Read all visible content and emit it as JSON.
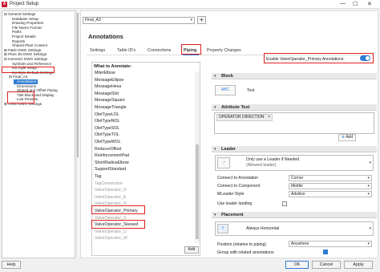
{
  "window": {
    "title": "Project Setup",
    "minimize": "—",
    "maximize": "☐",
    "close": "✕"
  },
  "tree": {
    "items": [
      {
        "label": "General Settings",
        "indent": 0,
        "prefix": "⊟"
      },
      {
        "label": "Database Setup",
        "indent": 1,
        "prefix": ""
      },
      {
        "label": "Drawing Properties",
        "indent": 1,
        "prefix": ""
      },
      {
        "label": "File Name Format",
        "indent": 1,
        "prefix": ""
      },
      {
        "label": "Paths",
        "indent": 1,
        "prefix": ""
      },
      {
        "label": "Project Details",
        "indent": 1,
        "prefix": ""
      },
      {
        "label": "Reports",
        "indent": 1,
        "prefix": ""
      },
      {
        "label": "Shared Plant Content",
        "indent": 1,
        "prefix": ""
      },
      {
        "label": "P&ID DWG Settings",
        "indent": 0,
        "prefix": "⊞"
      },
      {
        "label": "Plant 3D DWG Settings",
        "indent": 0,
        "prefix": "⊞"
      },
      {
        "label": "Isometric DWG Settings",
        "indent": 0,
        "prefix": "⊟"
      },
      {
        "label": "Symbols and Reference",
        "indent": 1,
        "prefix": ""
      },
      {
        "label": "Iso Style Setup",
        "indent": 1,
        "prefix": ""
      },
      {
        "label": "Iso Style Default Settings",
        "indent": 1,
        "prefix": ""
      },
      {
        "label": "Final_A3",
        "indent": 1,
        "prefix": "⊟"
      },
      {
        "label": "Annotations",
        "indent": 2,
        "prefix": ""
      },
      {
        "label": "Dimensions",
        "indent": 2,
        "prefix": ""
      },
      {
        "label": "Sloped and Offset Piping",
        "indent": 2,
        "prefix": ""
      },
      {
        "label": "Title Block and Display",
        "indent": 2,
        "prefix": ""
      },
      {
        "label": "Live Preview",
        "indent": 2,
        "prefix": ""
      },
      {
        "label": "Ortho DWG Settings",
        "indent": 0,
        "prefix": "⊞"
      }
    ]
  },
  "style_combo": {
    "value": "Final_A3"
  },
  "plus_label": "+",
  "heading": "Annotations",
  "tabs": [
    {
      "label": "Settings"
    },
    {
      "label": "Table ID's"
    },
    {
      "label": "Connections"
    },
    {
      "label": "Piping"
    },
    {
      "label": "Property Changes"
    }
  ],
  "toggle_label": "Enable ValveOperator_Primary Annotations:",
  "what_to_annotate": {
    "header": "What to Annotate:",
    "items": [
      {
        "label": "MiterElbow",
        "disabled": false
      },
      {
        "label": "MessageEllipse",
        "disabled": false
      },
      {
        "label": "MessageHexa",
        "disabled": false
      },
      {
        "label": "MessageSlot",
        "disabled": false
      },
      {
        "label": "MessageSquare",
        "disabled": false
      },
      {
        "label": "MessageTriangle",
        "disabled": false
      },
      {
        "label": "OletTypeLOL",
        "disabled": false
      },
      {
        "label": "OletTypeNOL",
        "disabled": false
      },
      {
        "label": "OletTypeSOL",
        "disabled": false
      },
      {
        "label": "OletTypeTOL",
        "disabled": false
      },
      {
        "label": "OletTypeWOL",
        "disabled": false
      },
      {
        "label": "ReducerOffset",
        "disabled": false
      },
      {
        "label": "ReinforcementPad",
        "disabled": false
      },
      {
        "label": "ShortRadiusElbow",
        "disabled": false
      },
      {
        "label": "SupportStandard",
        "disabled": false
      },
      {
        "label": "Tag",
        "disabled": false
      },
      {
        "label": "TapConnection",
        "disabled": true
      },
      {
        "label": "ValveOperator_D",
        "disabled": true
      },
      {
        "label": "ValveOperator_E",
        "disabled": true
      },
      {
        "label": "ValveOperator_N",
        "disabled": true
      },
      {
        "label": "ValveOperator_Primary",
        "disabled": false
      },
      {
        "label": "ValveOperator_S",
        "disabled": true
      },
      {
        "label": "ValveOperator_Skewed",
        "disabled": false
      },
      {
        "label": "ValveOperator_U",
        "disabled": true
      },
      {
        "label": "ValveOperator_W",
        "disabled": true
      }
    ],
    "add_label": "Add"
  },
  "block": {
    "title": "Block",
    "icon_text": "ABC",
    "value": "Text"
  },
  "attribute_text": {
    "title": "Attribute Text",
    "chip": "OPERATOR DIRECTION",
    "chip_close": "×",
    "add_label": "Add"
  },
  "leader": {
    "title": "Leader",
    "option_line1": "Only use a Leader if Needed",
    "option_line2": "(Allowed leader)",
    "rows": [
      {
        "label": "Connect to Annotation",
        "value": "Corner"
      },
      {
        "label": "Connect to Component",
        "value": "Middle"
      },
      {
        "label": "MLeader Style",
        "value": "Adsklso"
      }
    ],
    "landing_label": "Use leader landing"
  },
  "placement": {
    "title": "Placement",
    "option": "Always Horizontal",
    "rows": [
      {
        "label": "Position (relative to piping)",
        "value": "Anywhere"
      }
    ],
    "group_label": "Group with related annotations"
  },
  "buttons": {
    "help": "Help",
    "ok": "OK",
    "cancel": "Cancel",
    "apply": "Apply"
  },
  "colors": {
    "accent": "#2f7dd2",
    "highlight": "#e02020"
  }
}
